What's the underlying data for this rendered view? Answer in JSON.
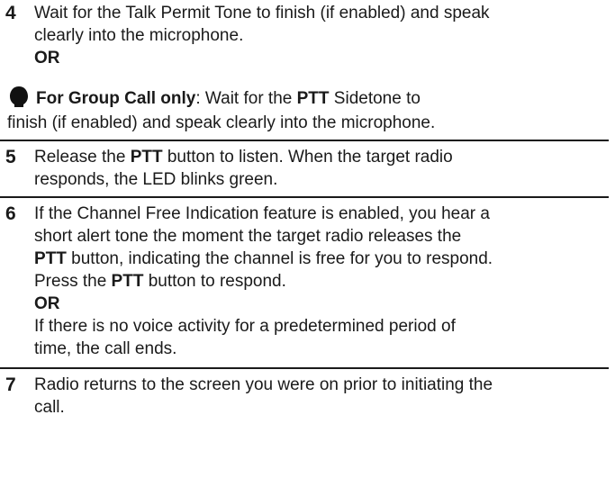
{
  "step4": {
    "number": "4",
    "line1": "Wait for the Talk Permit Tone to finish (if enabled) and speak",
    "line2": "clearly into the microphone.",
    "or": "OR",
    "group_label": "For Group Call only",
    "group_colon": ": Wait for the ",
    "group_ptt": "PTT",
    "group_rest": " Sidetone to",
    "line5": "finish (if enabled) and speak clearly into the microphone."
  },
  "step5": {
    "number": "5",
    "pre": "Release the ",
    "ptt": "PTT",
    "post": " button to listen. When the target radio",
    "line2": "responds, the LED blinks green."
  },
  "step6": {
    "number": "6",
    "line1": "If the Channel Free Indication feature is enabled, you hear a",
    "line2": "short alert tone the moment the target radio releases the",
    "ptt1": "PTT",
    "line3_rest": " button, indicating the channel is free for you to respond.",
    "line4_pre": "Press the ",
    "ptt2": "PTT",
    "line4_post": " button to respond.",
    "or": "OR",
    "line6": "If there is no voice activity for a predetermined period of",
    "line7": "time, the call ends."
  },
  "step7": {
    "number": "7",
    "line1": "Radio returns to the screen you were on prior to initiating the",
    "line2": "call."
  }
}
